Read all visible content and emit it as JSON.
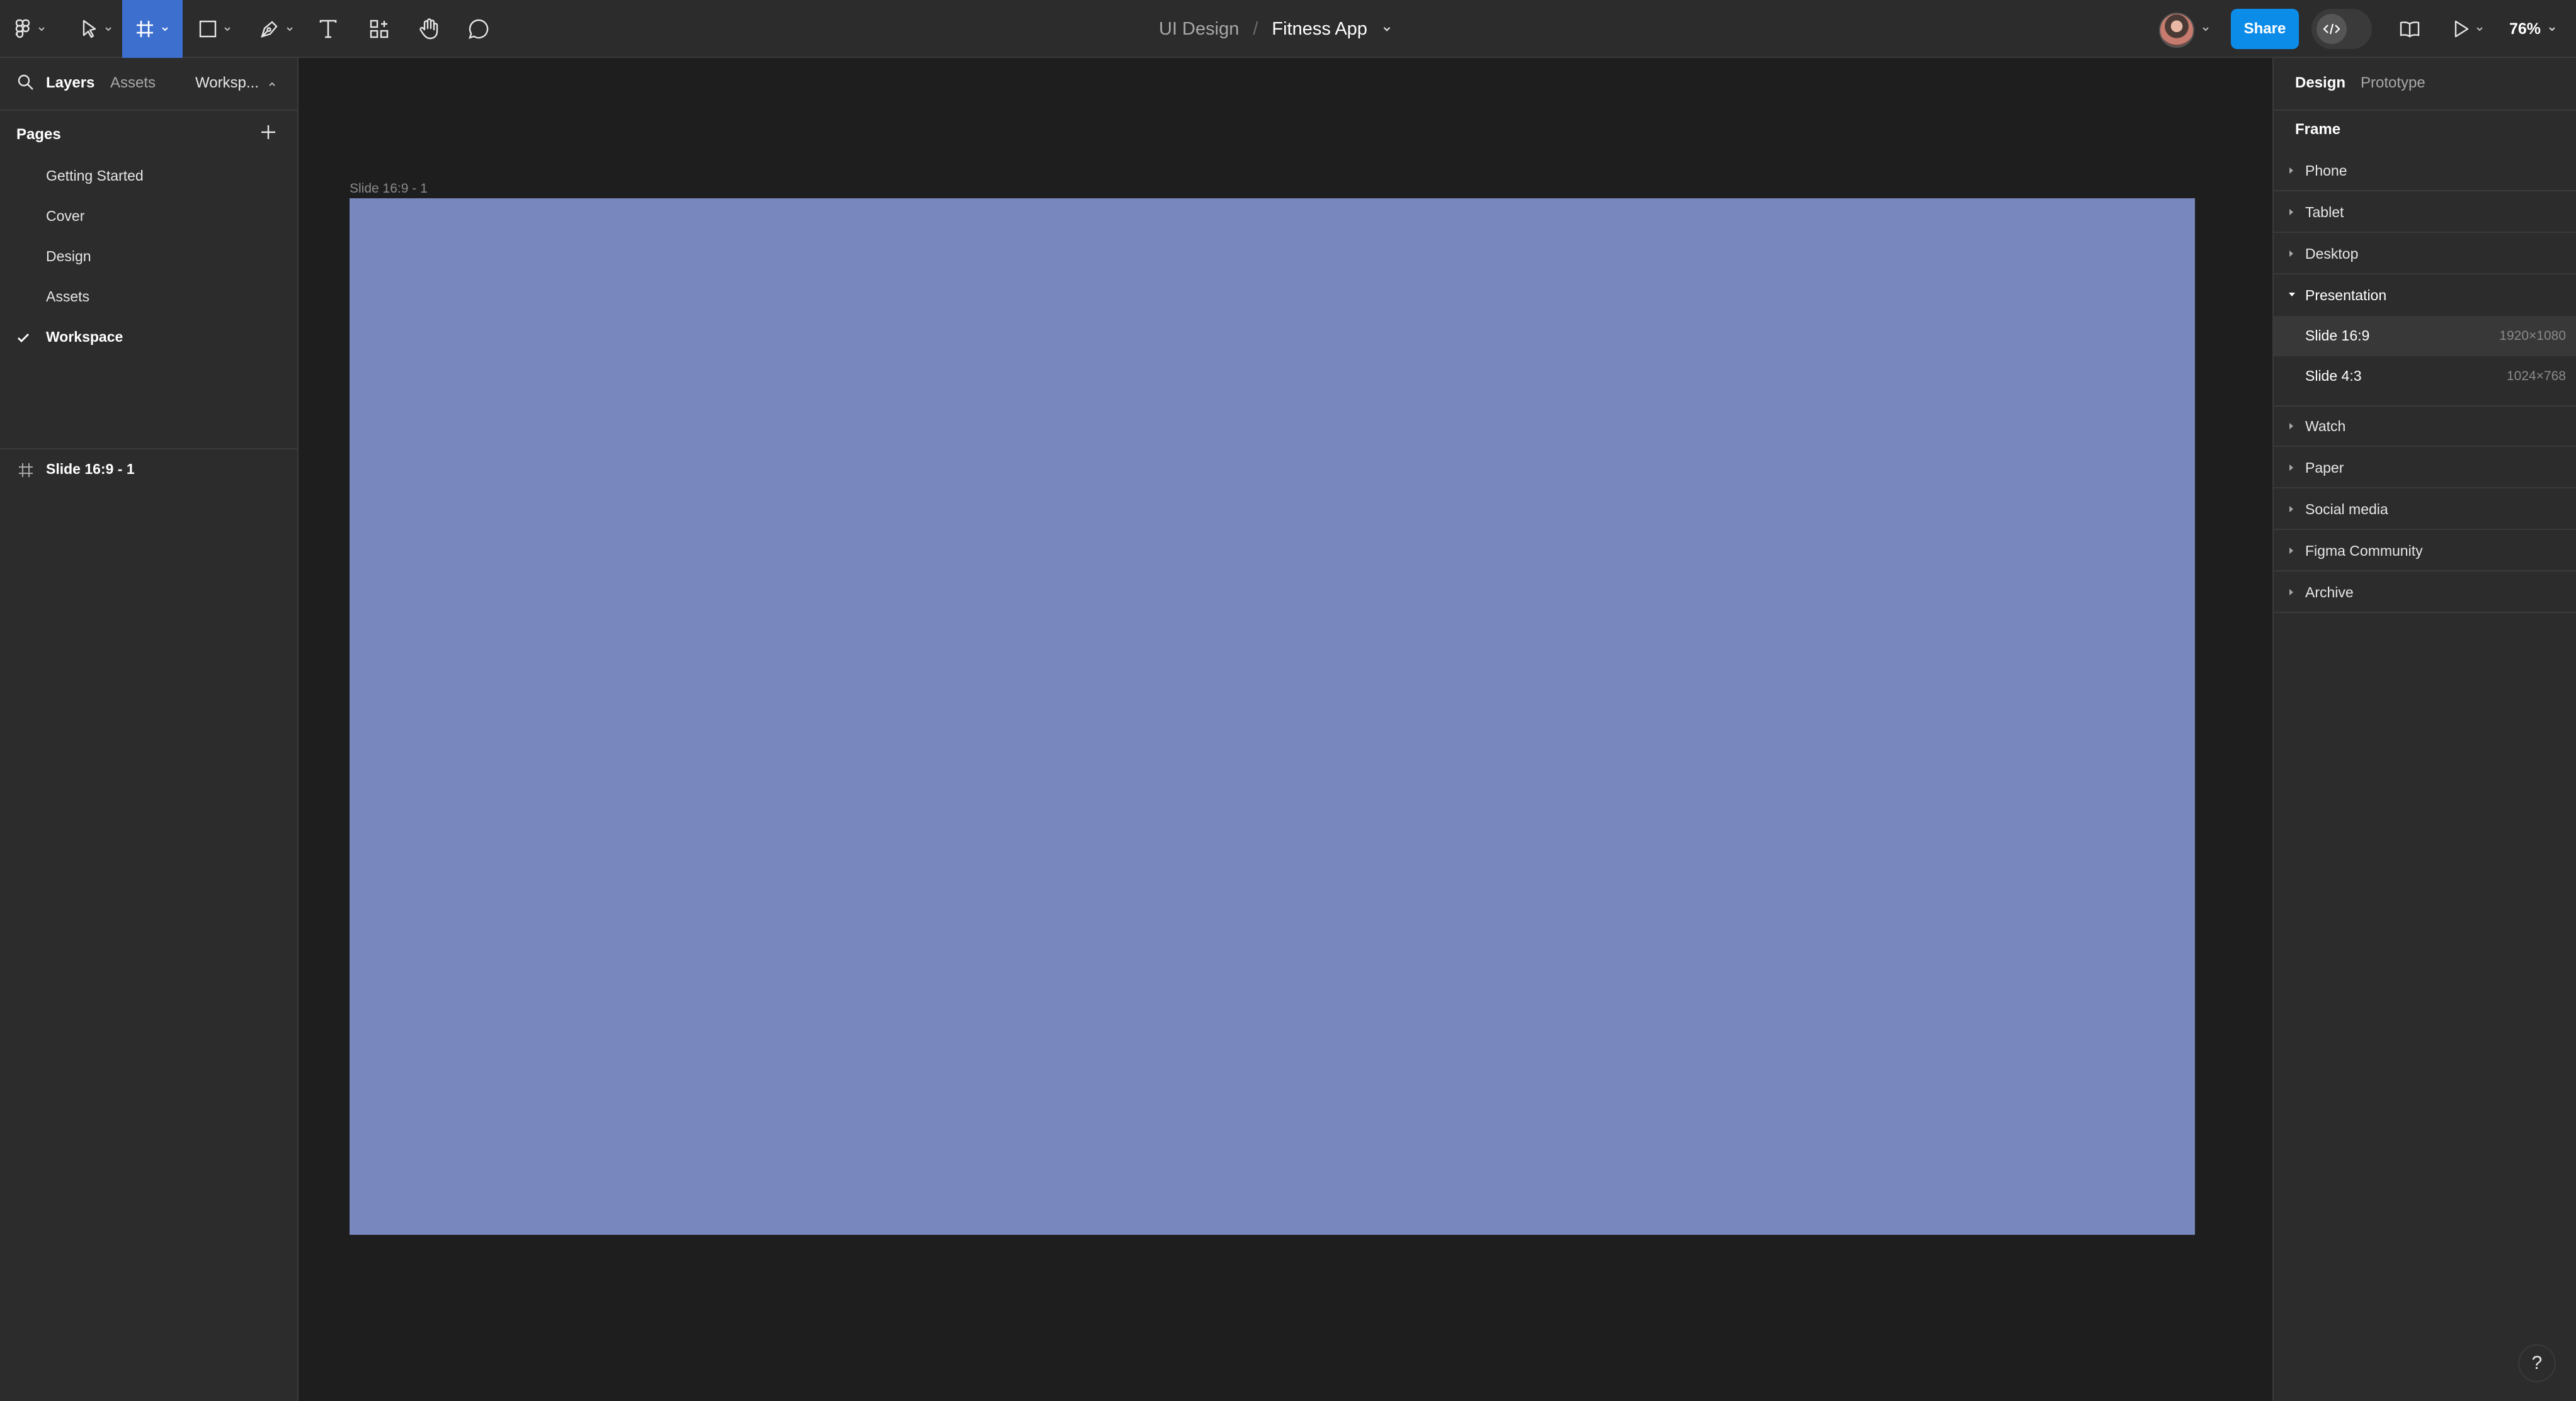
{
  "toolbar": {
    "project": "UI Design",
    "separator": "/",
    "file_name": "Fitness App",
    "share_label": "Share",
    "zoom": "76%",
    "icons": [
      "figma-menu-icon",
      "move-icon",
      "frame-icon",
      "rectangle-icon",
      "pen-icon",
      "text-icon",
      "resources-icon",
      "hand-icon",
      "comment-icon",
      "library-icon",
      "present-icon",
      "dev-mode-icon"
    ],
    "accent": "#0c8ce9"
  },
  "left_panel": {
    "tabs": [
      "Layers",
      "Assets"
    ],
    "workspace_dropdown": "Worksp...",
    "pages_header": "Pages",
    "pages": [
      {
        "label": "Getting Started"
      },
      {
        "label": "Cover"
      },
      {
        "label": "Design"
      },
      {
        "label": "Assets"
      },
      {
        "label": "Workspace",
        "current": true
      }
    ],
    "layers": [
      {
        "label": "Slide 16:9 - 1"
      }
    ]
  },
  "canvas": {
    "frame_label": "Slide 16:9 - 1",
    "frame_fill": "#7887bd",
    "background": "#1e1e1e"
  },
  "right_panel": {
    "tabs": [
      "Design",
      "Prototype"
    ],
    "section_title": "Frame",
    "categories_top": [
      "Phone",
      "Tablet",
      "Desktop"
    ],
    "open_category": "Presentation",
    "presets": [
      {
        "label": "Slide 16:9",
        "dims": "1920×1080",
        "highlighted": true
      },
      {
        "label": "Slide 4:3",
        "dims": "1024×768"
      }
    ],
    "categories_bottom": [
      "Watch",
      "Paper",
      "Social media",
      "Figma Community",
      "Archive"
    ]
  },
  "help_label": "?"
}
